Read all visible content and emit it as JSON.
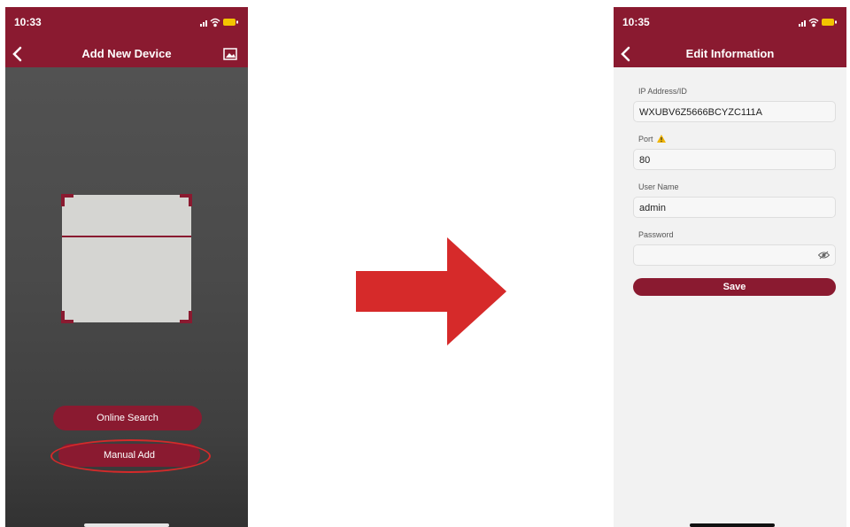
{
  "left_screen": {
    "status_time": "10:33",
    "title": "Add New Device",
    "online_search_label": "Online Search",
    "manual_add_label": "Manual Add",
    "icons": [
      "back-icon",
      "gallery-icon",
      "moon-icon",
      "signal-icon",
      "wifi-icon",
      "battery-icon"
    ]
  },
  "right_screen": {
    "status_time": "10:35",
    "title": "Edit Information",
    "fields": [
      {
        "label": "IP Address/ID",
        "value": "WXUBV6Z5666BCYZC111A"
      },
      {
        "label": "Port",
        "value": "80"
      },
      {
        "label": "User Name",
        "value": "admin"
      },
      {
        "label": "Password",
        "value": ""
      }
    ],
    "save_label": "Save",
    "icons": [
      "back-icon",
      "warning-icon",
      "eye-icon"
    ]
  },
  "colors": {
    "brand": "#8a1a30",
    "arrow": "#d62a2a",
    "highlight": "#d42a2a"
  }
}
